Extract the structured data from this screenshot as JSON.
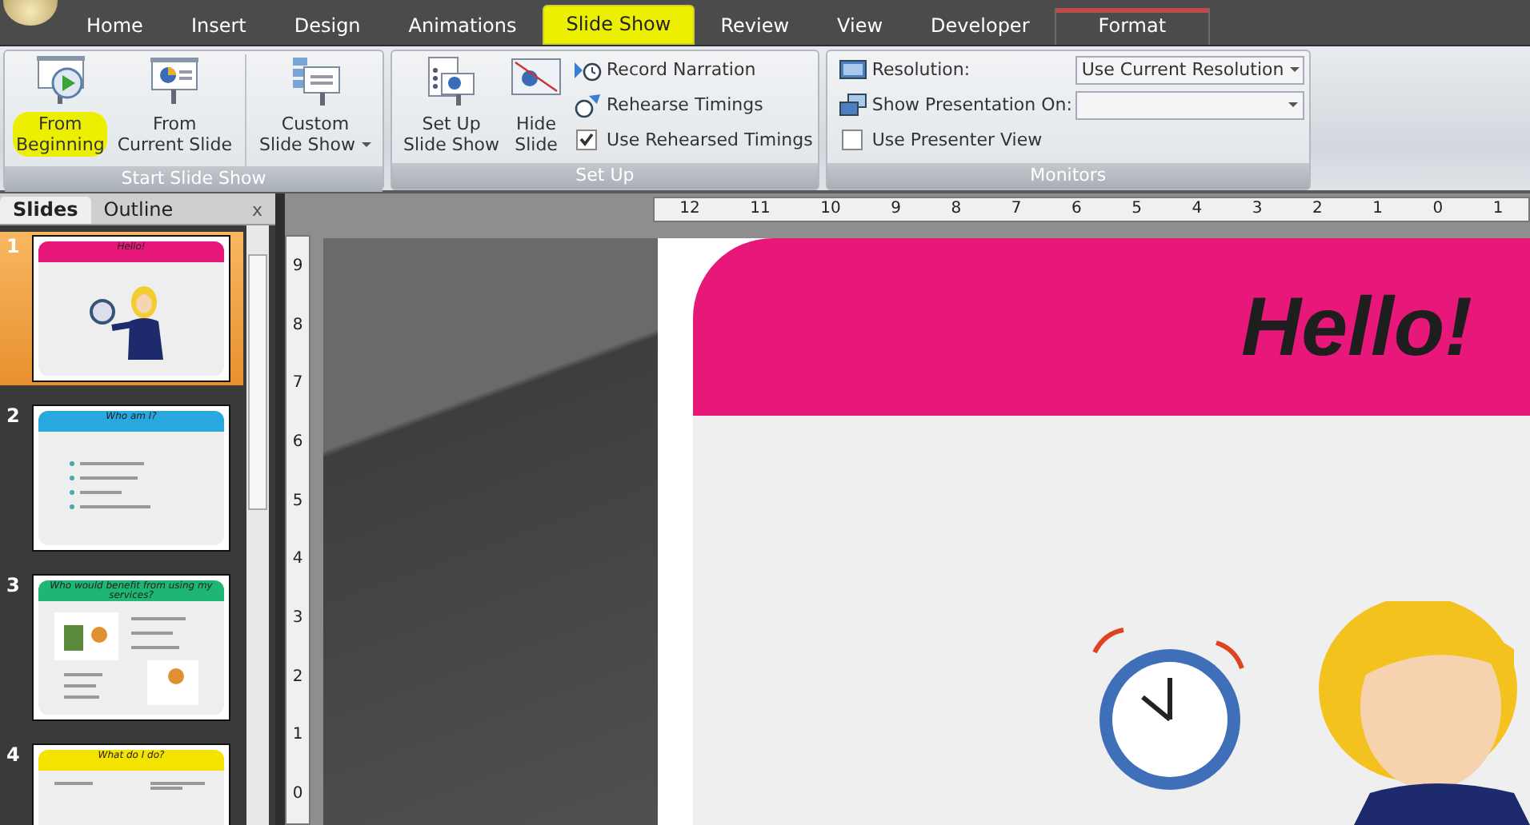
{
  "tabs": [
    {
      "label": "Home",
      "selected": false,
      "contextual": false
    },
    {
      "label": "Insert",
      "selected": false,
      "contextual": false
    },
    {
      "label": "Design",
      "selected": false,
      "contextual": false
    },
    {
      "label": "Animations",
      "selected": false,
      "contextual": false
    },
    {
      "label": "Slide Show",
      "selected": true,
      "contextual": false
    },
    {
      "label": "Review",
      "selected": false,
      "contextual": false
    },
    {
      "label": "View",
      "selected": false,
      "contextual": false
    },
    {
      "label": "Developer",
      "selected": false,
      "contextual": false
    },
    {
      "label": "Format",
      "selected": false,
      "contextual": true
    }
  ],
  "ribbon_groups": [
    {
      "title": "Start Slide Show",
      "controls": [
        {
          "kind": "large",
          "lines": [
            "From",
            "Beginning"
          ],
          "highlighted": true,
          "dropdown": false
        },
        {
          "kind": "large",
          "lines": [
            "From",
            "Current Slide"
          ],
          "highlighted": false,
          "dropdown": false
        },
        {
          "kind": "large",
          "lines": [
            "Custom",
            "Slide Show"
          ],
          "highlighted": false,
          "dropdown": true
        }
      ]
    },
    {
      "title": "Set Up",
      "controls": [
        {
          "kind": "large",
          "lines": [
            "Set Up",
            "Slide Show"
          ],
          "highlighted": false,
          "dropdown": false
        },
        {
          "kind": "large",
          "lines": [
            "Hide",
            "Slide"
          ],
          "highlighted": false,
          "dropdown": false
        },
        {
          "kind": "stack",
          "items": [
            {
              "kind": "small",
              "label": "Record Narration"
            },
            {
              "kind": "small",
              "label": "Rehearse Timings"
            },
            {
              "kind": "checkbox",
              "label": "Use Rehearsed Timings",
              "checked": true
            }
          ]
        }
      ]
    },
    {
      "title": "Monitors",
      "controls": [
        {
          "kind": "stack",
          "items": [
            {
              "kind": "dropdown",
              "label": "Resolution:",
              "value": "Use Current Resolution"
            },
            {
              "kind": "dropdown",
              "label": "Show Presentation On:"
            },
            {
              "kind": "checkbox",
              "label": "Use Presenter View",
              "checked": false
            }
          ]
        }
      ]
    }
  ],
  "pane": {
    "tabs": [
      {
        "label": "Slides",
        "selected": true
      },
      {
        "label": "Outline",
        "selected": false
      }
    ],
    "close": "x",
    "slides": [
      {
        "number": "1",
        "title": "Hello!",
        "color": "#e8177a",
        "selected": true,
        "kind": "figure"
      },
      {
        "number": "2",
        "title": "Who am I?",
        "color": "#29a8df",
        "selected": false,
        "kind": "bullets"
      },
      {
        "number": "3",
        "title": "Who would benefit from using my services?",
        "color": "#1fb574",
        "selected": false,
        "kind": "pictures"
      },
      {
        "number": "4",
        "title": "What do I do?",
        "color": "#f4e200",
        "selected": false,
        "kind": "columns"
      }
    ]
  },
  "rulers": {
    "horizontal": [
      "12",
      "11",
      "10",
      "9",
      "8",
      "7",
      "6",
      "5",
      "4",
      "3",
      "2",
      "1",
      "0",
      "1"
    ],
    "vertical": [
      "9",
      "8",
      "7",
      "6",
      "5",
      "4",
      "3",
      "2",
      "1",
      "0"
    ]
  },
  "slide": {
    "title": "Hello!"
  }
}
